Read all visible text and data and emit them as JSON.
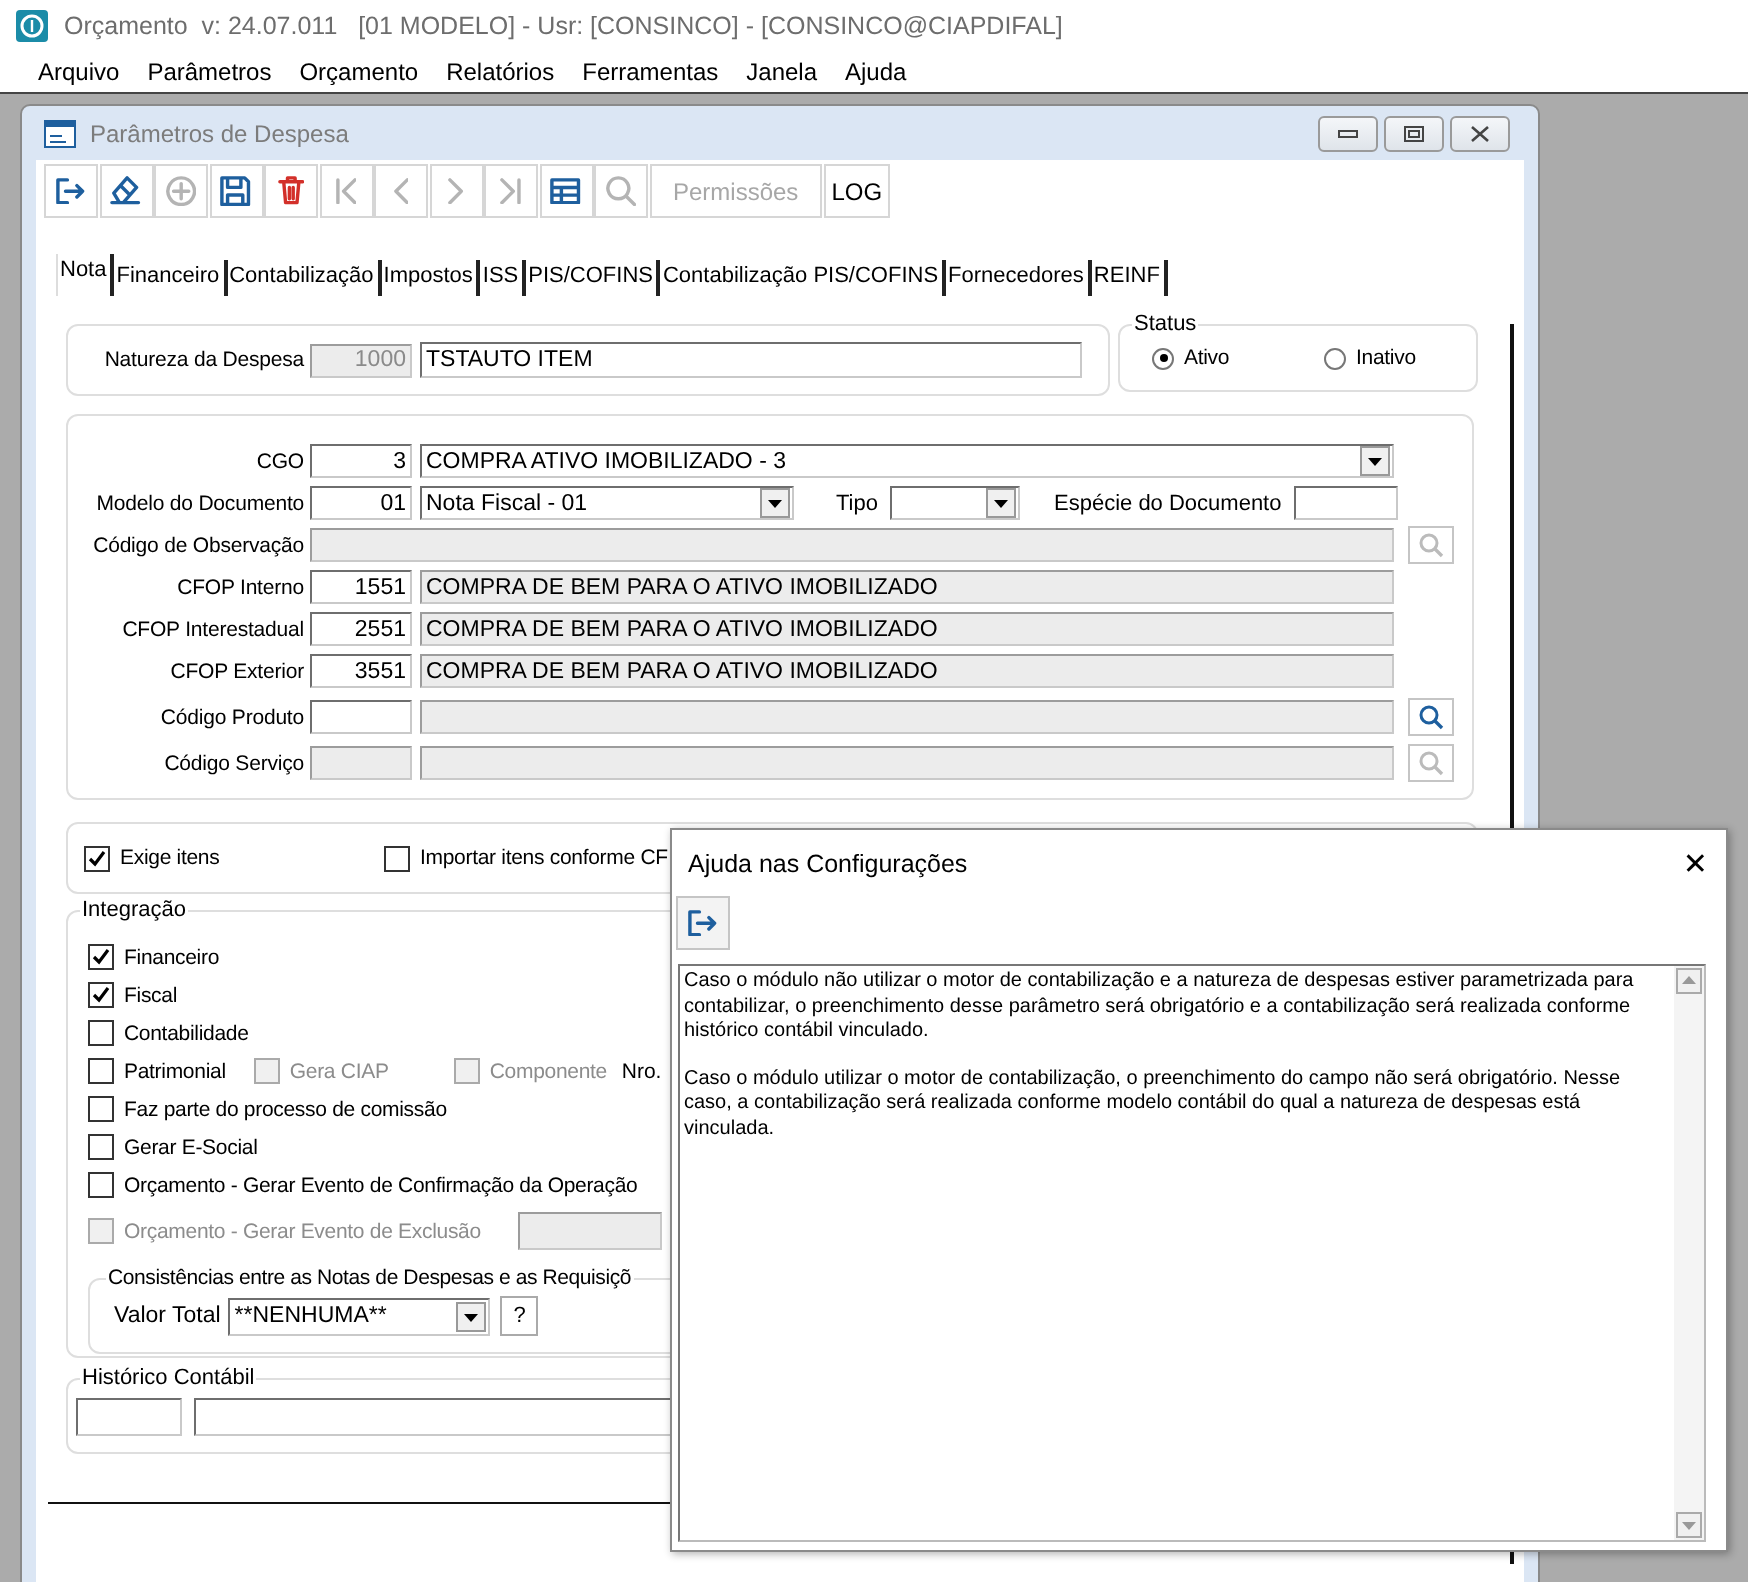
{
  "app_window": {
    "title": "Orçamento  v: 24.07.011   [01 MODELO] - Usr: [CONSINCO] - [CONSINCO@CIAPDIFAL]"
  },
  "menu": [
    "Arquivo",
    "Parâmetros",
    "Orçamento",
    "Relatórios",
    "Ferramentas",
    "Janela",
    "Ajuda"
  ],
  "form_window": {
    "title": "Parâmetros de Despesa"
  },
  "toolbar": [
    {
      "kind": "exit",
      "disabled": false
    },
    {
      "kind": "clear",
      "disabled": false
    },
    {
      "kind": "add",
      "disabled": true
    },
    {
      "kind": "save",
      "disabled": false
    },
    {
      "kind": "delete",
      "disabled": false
    },
    {
      "kind": "first",
      "disabled": true
    },
    {
      "kind": "previous",
      "disabled": true
    },
    {
      "kind": "next",
      "disabled": true
    },
    {
      "kind": "last",
      "disabled": true
    },
    {
      "kind": "grid",
      "disabled": false
    },
    {
      "kind": "search",
      "disabled": true
    },
    {
      "kind": "text",
      "label": "Permissões",
      "disabled": true
    },
    {
      "kind": "text",
      "label": "LOG",
      "disabled": false
    }
  ],
  "tabs": [
    {
      "label": "Nota",
      "selected": true
    },
    {
      "label": "Financeiro",
      "selected": false
    },
    {
      "label": "Contabilização",
      "selected": false
    },
    {
      "label": "Impostos",
      "selected": false
    },
    {
      "label": "ISS",
      "selected": false
    },
    {
      "label": "PIS/COFINS",
      "selected": false
    },
    {
      "label": "Contabilização PIS/COFINS",
      "selected": false
    },
    {
      "label": "Fornecedores",
      "selected": false
    },
    {
      "label": "REINF",
      "selected": false
    }
  ],
  "natureza": {
    "label": "Natureza da Despesa",
    "code": "1000",
    "name": "TSTAUTO ITEM"
  },
  "status": {
    "label": "Status",
    "options": [
      {
        "label": "Ativo",
        "selected": true
      },
      {
        "label": "Inativo",
        "selected": false
      }
    ]
  },
  "rows": [
    {
      "kind": "combo",
      "label": "CGO",
      "code": "3",
      "value": "COMPRA ATIVO IMOBILIZADO - 3"
    },
    {
      "kind": "modelo",
      "label": "Modelo do Documento",
      "code": "01",
      "value": "Nota Fiscal - 01",
      "tipo_label": "Tipo",
      "especie_label": "Espécie do Documento"
    },
    {
      "kind": "wide",
      "label": "Código de Observação",
      "lookup_disabled": true
    },
    {
      "kind": "text",
      "label": "CFOP Interno",
      "code": "1551",
      "value": "COMPRA DE BEM PARA O ATIVO IMOBILIZADO"
    },
    {
      "kind": "text",
      "label": "CFOP Interestadual",
      "code": "2551",
      "value": "COMPRA DE BEM PARA O ATIVO IMOBILIZADO"
    },
    {
      "kind": "text",
      "label": "CFOP Exterior",
      "code": "3551",
      "value": "COMPRA DE BEM PARA O ATIVO IMOBILIZADO"
    },
    {
      "kind": "lookup",
      "label": "Código Produto",
      "code_disabled": false,
      "lookup_disabled": false
    },
    {
      "kind": "lookup",
      "label": "Código Serviço",
      "code_disabled": true,
      "lookup_disabled": true
    }
  ],
  "options": [
    {
      "label": "Exige itens",
      "checked": true
    },
    {
      "label": "Importar itens conforme CF",
      "checked": false
    }
  ],
  "integracao": {
    "label": "Integração",
    "items": [
      {
        "kind": "check",
        "label": "Financeiro",
        "checked": true,
        "disabled": false
      },
      {
        "kind": "check",
        "label": "Fiscal",
        "checked": true,
        "disabled": false
      },
      {
        "kind": "check",
        "label": "Contabilidade",
        "checked": false,
        "disabled": false
      },
      {
        "kind": "patrimonial",
        "label": "Patrimonial",
        "checked": false,
        "disabled": false,
        "extras": [
          {
            "label": "Gera CIAP",
            "checked": false,
            "disabled": true
          },
          {
            "label": "Componente",
            "checked": false,
            "disabled": true
          }
        ],
        "suffix": "Nro."
      },
      {
        "kind": "check",
        "label": "Faz parte do processo de comissão",
        "checked": false,
        "disabled": false
      },
      {
        "kind": "check",
        "label": "Gerar E-Social",
        "checked": false,
        "disabled": false
      },
      {
        "kind": "check",
        "label": "Orçamento - Gerar Evento de Confirmação da Operação",
        "checked": false,
        "disabled": false
      },
      {
        "kind": "check_field",
        "label": "Orçamento -  Gerar Evento de Exclusão",
        "checked": false,
        "disabled": true
      }
    ],
    "consistencias": {
      "label": "Consistências entre as Notas de Despesas e as Requisiçõ",
      "field_label": "Valor Total",
      "value": "**NENHUMA**",
      "help": "?"
    }
  },
  "historico": {
    "label": "Histórico Contábil"
  },
  "help_dialog": {
    "title": "Ajuda nas Configurações",
    "close": "✕",
    "paragraphs": [
      "Caso o módulo não utilizar o motor de contabilização e a natureza de despesas estiver parametrizada para contabilizar, o preenchimento desse parâmetro será obrigatório e a contabilização será realizada conforme histórico contábil vinculado.",
      "Caso o módulo utilizar o motor de contabilização, o preenchimento do campo não será obrigatório. Nesse caso, a contabilização será realizada conforme modelo contábil do qual a natureza de despesas está vinculada."
    ]
  }
}
